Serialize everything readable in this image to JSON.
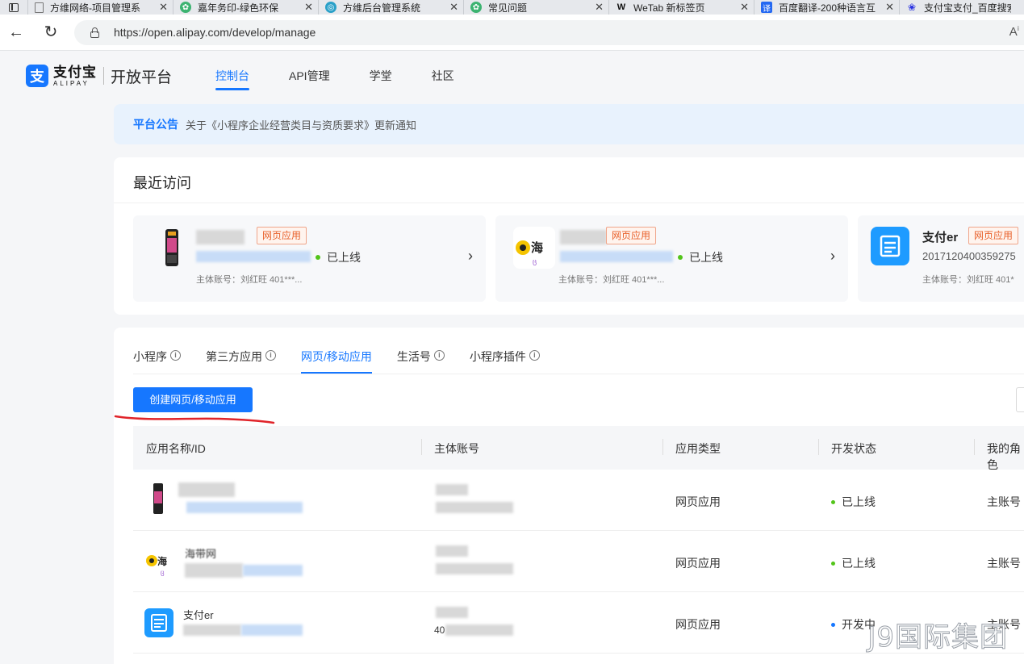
{
  "browser": {
    "tabs": [
      {
        "title": "方维网络-项目管理系",
        "icon": "document-icon",
        "icon_color": "#888888"
      },
      {
        "title": "嘉年务印-绿色环保",
        "icon": "leaf-icon",
        "icon_color": "#3cb371"
      },
      {
        "title": "方维后台管理系统",
        "icon": "globe-icon",
        "icon_color": "#2aa0c8"
      },
      {
        "title": "常见问题",
        "icon": "leaf-icon",
        "icon_color": "#3cb371"
      },
      {
        "title": "WeTab 新标签页",
        "icon": "wetab-icon",
        "icon_color": "#111111"
      },
      {
        "title": "百度翻译-200种语言互",
        "icon": "translate-icon",
        "icon_color": "#2468f2"
      },
      {
        "title": "支付宝支付_百度搜索",
        "icon": "baidu-paw-icon",
        "icon_color": "#2932e1"
      }
    ],
    "url": "https://open.alipay.com/develop/manage"
  },
  "header": {
    "logo_cn": "支付宝",
    "logo_en": "ALIPAY",
    "platform": "开放平台",
    "nav": [
      {
        "label": "控制台",
        "active": true
      },
      {
        "label": "API管理",
        "active": false
      },
      {
        "label": "学堂",
        "active": false
      },
      {
        "label": "社区",
        "active": false
      }
    ]
  },
  "notice": {
    "label": "平台公告",
    "text": "关于《小程序企业经营类目与资质要求》更新通知"
  },
  "recent": {
    "title": "最近访问",
    "cards": [
      {
        "name": "",
        "tag": "网页应用",
        "id": "",
        "status": "已上线",
        "status_color": "#52c41a",
        "account": "主体账号：刘红旺 401***..."
      },
      {
        "name": "",
        "tag": "网页应用",
        "id": "",
        "status": "已上线",
        "status_color": "#52c41a",
        "account": "主体账号：刘红旺 401***..."
      },
      {
        "name": "支付er",
        "tag": "网页应用",
        "id": "2017120400359275",
        "status": "",
        "status_color": "#52c41a",
        "account": "主体账号：刘红旺 401*"
      }
    ]
  },
  "apps": {
    "tabs": [
      {
        "label": "小程序",
        "info": true,
        "active": false
      },
      {
        "label": "第三方应用",
        "info": true,
        "active": false
      },
      {
        "label": "网页/移动应用",
        "info": false,
        "active": true
      },
      {
        "label": "生活号",
        "info": true,
        "active": false
      },
      {
        "label": "小程序插件",
        "info": true,
        "active": false
      }
    ],
    "create_button": "创建网页/移动应用",
    "columns": [
      "应用名称/ID",
      "主体账号",
      "应用类型",
      "开发状态",
      "我的角色"
    ],
    "rows": [
      {
        "name": "",
        "account": "",
        "type": "网页应用",
        "status": "已上线",
        "status_color": "#52c41a",
        "role": "主账号"
      },
      {
        "name": "海带网",
        "account": "",
        "type": "网页应用",
        "status": "已上线",
        "status_color": "#52c41a",
        "role": "主账号"
      },
      {
        "name": "支付er",
        "account": "40",
        "type": "网页应用",
        "status": "开发中",
        "status_color": "#1677ff",
        "role": "主账号"
      }
    ]
  },
  "watermark": "J9国际集团",
  "colors": {
    "accent": "#1677ff",
    "tag": "#e8602a",
    "online": "#52c41a"
  }
}
